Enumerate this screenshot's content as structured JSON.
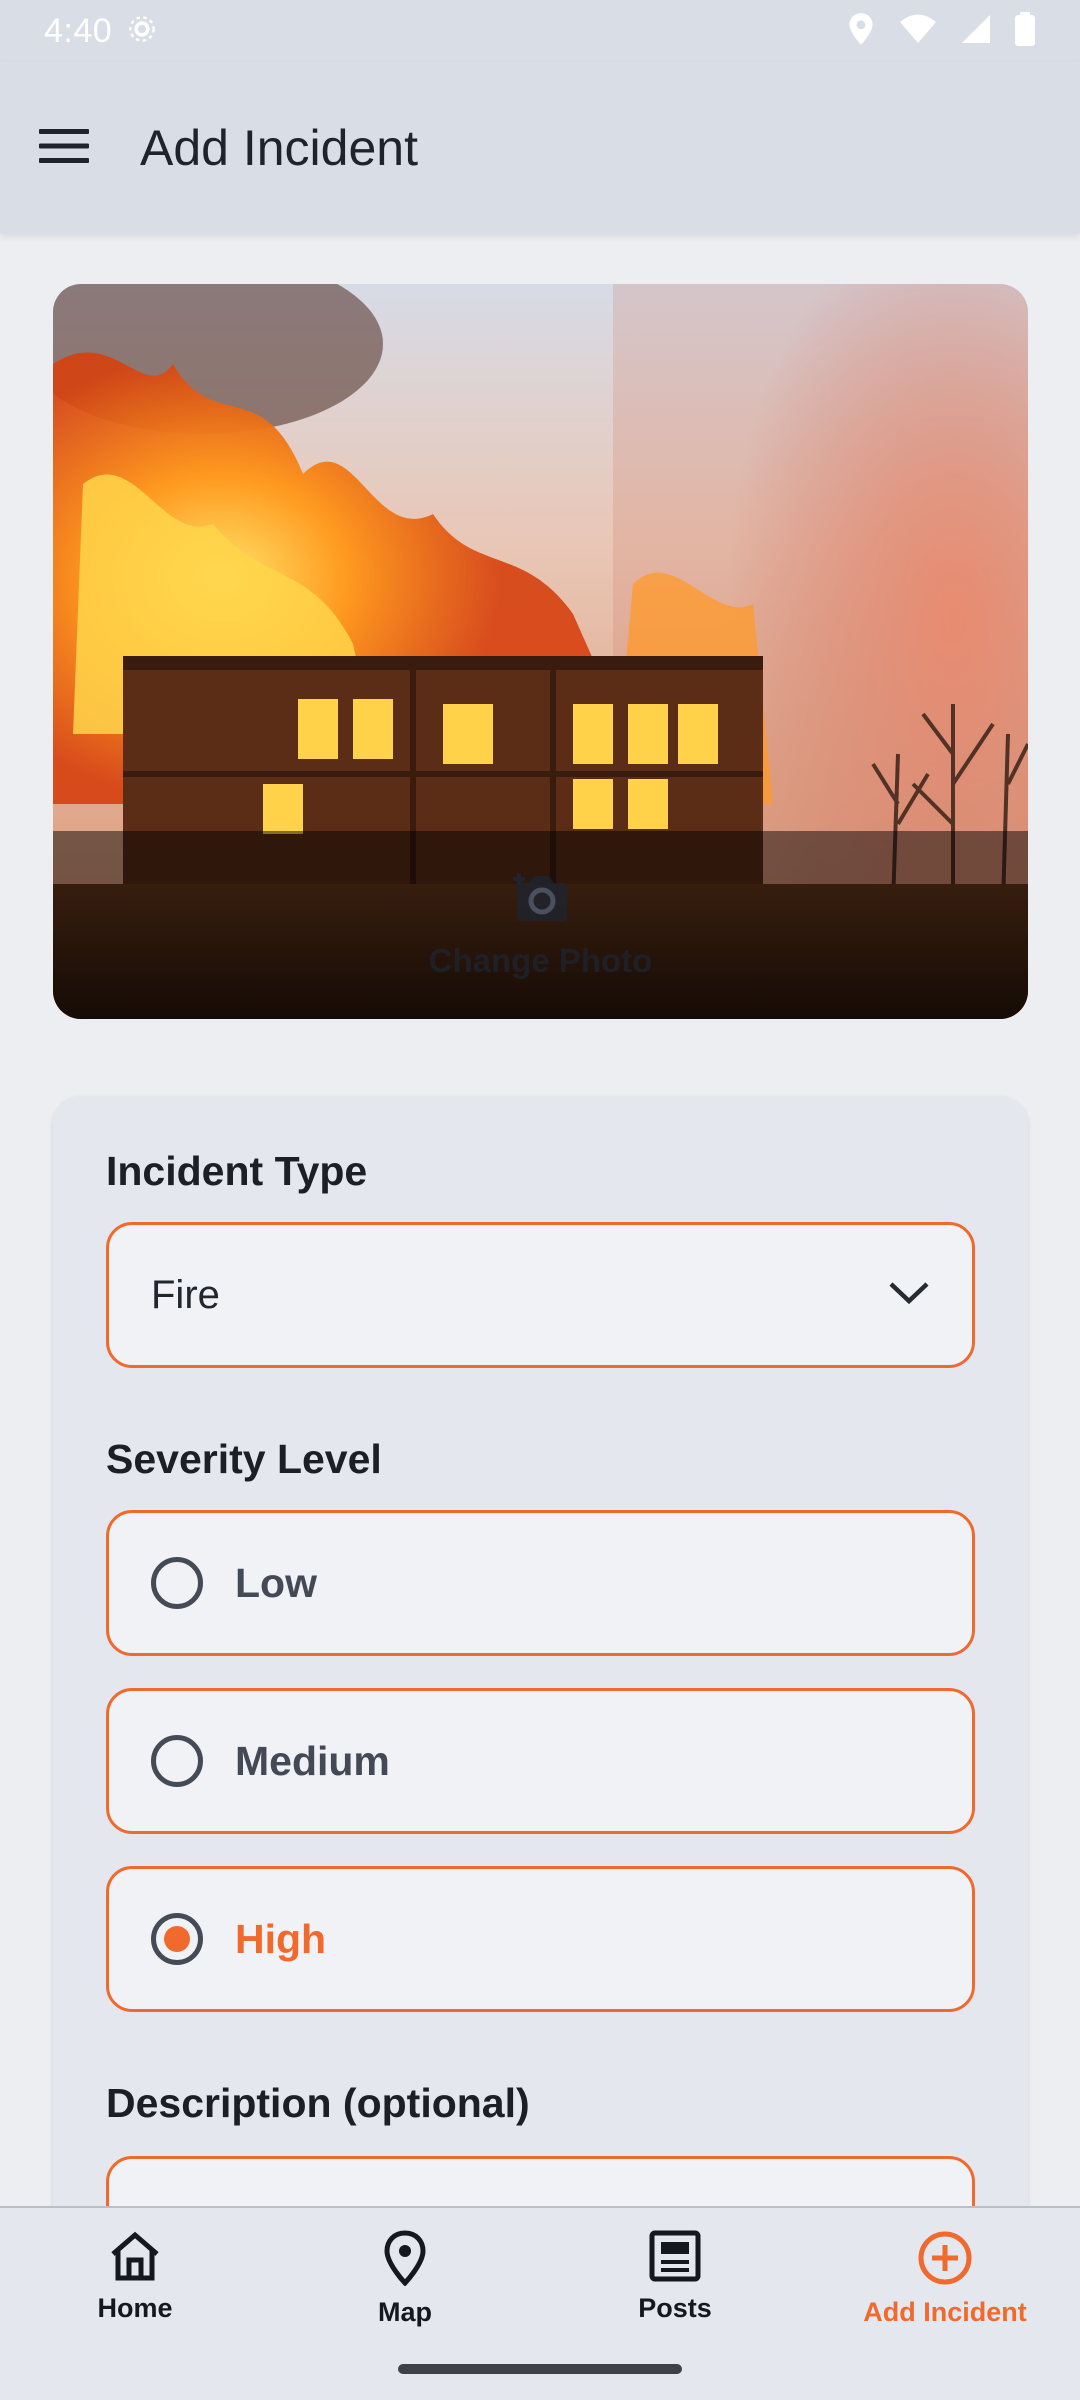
{
  "status_bar": {
    "time": "4:40",
    "icons": [
      "location-icon",
      "wifi-icon",
      "signal-icon",
      "battery-icon"
    ]
  },
  "app_bar": {
    "title": "Add Incident",
    "menu_icon": "hamburger-menu-icon"
  },
  "photo": {
    "description_icon": "camera-icon",
    "change_label": "Change Photo"
  },
  "form": {
    "incident_type": {
      "label": "Incident Type",
      "value": "Fire"
    },
    "severity": {
      "label": "Severity Level",
      "options": [
        {
          "label": "Low",
          "selected": false
        },
        {
          "label": "Medium",
          "selected": false
        },
        {
          "label": "High",
          "selected": true
        }
      ]
    },
    "description": {
      "label": "Description (optional)"
    }
  },
  "bottom_nav": {
    "items": [
      {
        "label": "Home",
        "icon": "home-icon"
      },
      {
        "label": "Map",
        "icon": "map-pin-icon"
      },
      {
        "label": "Posts",
        "icon": "posts-icon"
      },
      {
        "label": "Add Incident",
        "icon": "add-circle-icon"
      }
    ],
    "active_index": 3
  },
  "colors": {
    "accent": "#f0692d",
    "app_bar": "#d9dde5",
    "background": "#eceef2"
  }
}
